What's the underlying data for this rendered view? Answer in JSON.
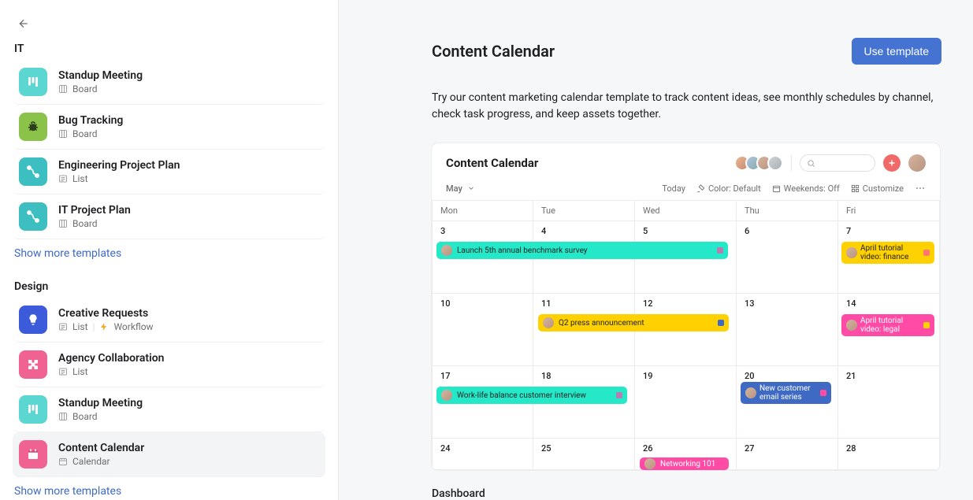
{
  "sidebar": {
    "sections": [
      {
        "title": "IT",
        "items": [
          {
            "name": "Standup Meeting",
            "meta": [
              {
                "icon": "board",
                "label": "Board"
              }
            ],
            "iconColor": "#37c2c4",
            "iconType": "board"
          },
          {
            "name": "Bug Tracking",
            "meta": [
              {
                "icon": "board",
                "label": "Board"
              }
            ],
            "iconColor": "#8bc34a",
            "iconType": "bug"
          },
          {
            "name": "Engineering Project Plan",
            "meta": [
              {
                "icon": "list",
                "label": "List"
              }
            ],
            "iconColor": "#37c2c4",
            "iconType": "path"
          },
          {
            "name": "IT Project Plan",
            "meta": [
              {
                "icon": "board",
                "label": "Board"
              }
            ],
            "iconColor": "#37c2c4",
            "iconType": "path"
          }
        ],
        "showMore": "Show more templates"
      },
      {
        "title": "Design",
        "items": [
          {
            "name": "Creative Requests",
            "meta": [
              {
                "icon": "list",
                "label": "List"
              },
              {
                "icon": "workflow",
                "label": "Workflow"
              }
            ],
            "iconColor": "#3b5bdb",
            "iconType": "bulb"
          },
          {
            "name": "Agency Collaboration",
            "meta": [
              {
                "icon": "list",
                "label": "List"
              }
            ],
            "iconColor": "#f06292",
            "iconType": "puzzle"
          },
          {
            "name": "Standup Meeting",
            "meta": [
              {
                "icon": "board",
                "label": "Board"
              }
            ],
            "iconColor": "#37c2c4",
            "iconType": "board"
          },
          {
            "name": "Content Calendar",
            "meta": [
              {
                "icon": "calendar",
                "label": "Calendar"
              }
            ],
            "iconColor": "#f06292",
            "iconType": "calendar",
            "selected": true
          }
        ],
        "showMore": "Show more templates"
      }
    ]
  },
  "main": {
    "title": "Content Calendar",
    "useButton": "Use template",
    "description": "Try our content marketing calendar template to track content ideas, see monthly schedules by channel, check task progress, and keep assets together.",
    "sectionAfter": "Dashboard"
  },
  "preview": {
    "title": "Content Calendar",
    "month": "May",
    "toolbar": {
      "today": "Today",
      "color": "Color: Default",
      "weekends": "Weekends: Off",
      "customize": "Customize"
    },
    "dayHeaders": [
      "Mon",
      "Tue",
      "Wed",
      "Thu",
      "Fri"
    ],
    "weeks": [
      {
        "dates": [
          "3",
          "4",
          "5",
          "6",
          "7"
        ]
      },
      {
        "dates": [
          "10",
          "11",
          "12",
          "13",
          "14"
        ]
      },
      {
        "dates": [
          "17",
          "18",
          "19",
          "20",
          "21"
        ]
      },
      {
        "dates": [
          "24",
          "25",
          "26",
          "27",
          "28"
        ]
      }
    ],
    "events": {
      "w0_benchmark": "Launch 5th annual benchmark survey",
      "w0_finance1": "April tutorial",
      "w0_finance2": "video: finance",
      "w1_q2": "Q2 press announcement",
      "w1_legal1": "April tutorial",
      "w1_legal2": "video: legal",
      "w2_interview": "Work-life balance customer interview",
      "w2_email1": "New customer",
      "w2_email2": "email series",
      "w3_net": "Networking 101"
    }
  }
}
